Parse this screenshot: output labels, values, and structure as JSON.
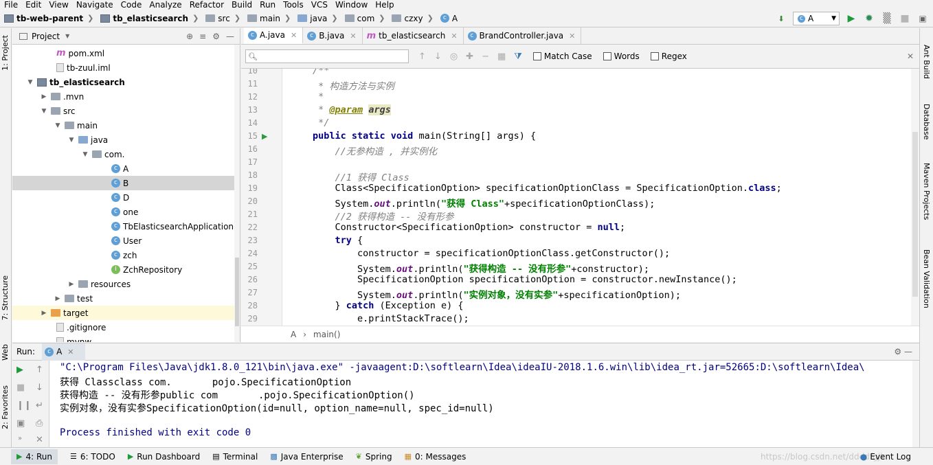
{
  "menu": [
    "File",
    "Edit",
    "View",
    "Navigate",
    "Code",
    "Analyze",
    "Refactor",
    "Build",
    "Run",
    "Tools",
    "VCS",
    "Window",
    "Help"
  ],
  "nav": {
    "crumbs": [
      "tb-web-parent",
      "tb_elasticsearch",
      "src",
      "main",
      "java",
      "com",
      "czxy",
      "A"
    ],
    "run_config": "A"
  },
  "left_strip": {
    "project": "1: Project",
    "structure": "7: Structure",
    "web": "Web",
    "favorites": "2: Favorites"
  },
  "right_strip": [
    "Ant Build",
    "Database",
    "Maven Projects",
    "Bean Validation"
  ],
  "project_panel": {
    "title": "Project",
    "rows": [
      {
        "label": "pom.xml"
      },
      {
        "label": "tb-zuul.iml"
      },
      {
        "label": "tb_elasticsearch"
      },
      {
        "label": ".mvn"
      },
      {
        "label": "src"
      },
      {
        "label": "main"
      },
      {
        "label": "java"
      },
      {
        "label": "com."
      },
      {
        "label": "A"
      },
      {
        "label": "B"
      },
      {
        "label": "D"
      },
      {
        "label": "one"
      },
      {
        "label": "TbElasticsearchApplication"
      },
      {
        "label": "User"
      },
      {
        "label": "zch"
      },
      {
        "label": "ZchRepository"
      },
      {
        "label": "resources"
      },
      {
        "label": "test"
      },
      {
        "label": "target"
      },
      {
        "label": ".gitignore"
      },
      {
        "label": "mvnw"
      }
    ]
  },
  "editor": {
    "tabs": [
      "A.java",
      "B.java",
      "tb_elasticsearch",
      "BrandController.java"
    ],
    "search": {
      "placeholder": "",
      "match_case": "Match Case",
      "words": "Words",
      "regex": "Regex"
    },
    "line_numbers": [
      "10",
      "11",
      "12",
      "13",
      "14",
      "15",
      "16",
      "17",
      "18",
      "19",
      "20",
      "21",
      "22",
      "23",
      "24",
      "25",
      "26",
      "27",
      "28",
      "29"
    ],
    "code": {
      "l10": "/**",
      "l11": " * 构造方法与实例",
      "l12": " *",
      "l13_pre": " * ",
      "l13_tag": "@param",
      "l13_sp": " ",
      "l13_arg": "args",
      "l14": " */",
      "l15_kw": "public static void",
      "l15_rest": " main(String[] args) {",
      "l16": "    //无参构造 , 并实例化",
      "l18": "    //1 获得 Class",
      "l19_pre": "    Class<SpecificationOption> specificationOptionClass = SpecificationOption.",
      "l19_kw": "class",
      "l19_end": ";",
      "l20_pre": "    System.",
      "l20_out": "out",
      "l20_mid": ".println(",
      "l20_str": "\"获得 Class\"",
      "l20_end": "+specificationOptionClass);",
      "l21": "    //2 获得构造 -- 没有形参",
      "l22_pre": "    Constructor<SpecificationOption> constructor = ",
      "l22_kw": "null",
      "l22_end": ";",
      "l23_kw": "    try",
      "l23_end": " {",
      "l24": "        constructor = specificationOptionClass.getConstructor();",
      "l25_pre": "        System.",
      "l25_out": "out",
      "l25_mid": ".println(",
      "l25_str": "\"获得构造 -- 没有形参\"",
      "l25_end": "+constructor);",
      "l26": "        SpecificationOption specificationOption = constructor.newInstance();",
      "l27_pre": "        System.",
      "l27_out": "out",
      "l27_mid": ".println(",
      "l27_str": "\"实例对象，没有实参\"",
      "l27_end": "+specificationOption);",
      "l28_pre": "    } ",
      "l28_kw": "catch",
      "l28_end": " (Exception e) {",
      "l29": "        e.printStackTrace();"
    },
    "breadcrumb": [
      "A",
      "main()"
    ]
  },
  "run": {
    "label": "Run:",
    "tab": "A",
    "console": [
      "\"C:\\Program Files\\Java\\jdk1.8.0_121\\bin\\java.exe\" -javaagent:D:\\softlearn\\Idea\\ideaIU-2018.1.6.win\\lib\\idea_rt.jar=52665:D:\\softlearn\\Idea\\",
      "获得 Classclass com.       pojo.SpecificationOption",
      "获得构造 -- 没有形参public com       .pojo.SpecificationOption()",
      "实例对象，没有实参SpecificationOption(id=null, option_name=null, spec_id=null)",
      "",
      "Process finished with exit code 0"
    ]
  },
  "statusbar": {
    "run": "4: Run",
    "todo": "6: TODO",
    "run_dashboard": "Run Dashboard",
    "terminal": "Terminal",
    "java_enterprise": "Java Enterprise",
    "spring": "Spring",
    "messages": "0: Messages",
    "watermark": "https://blog.csdn.net/ddddfgjk",
    "event_log": "Event Log"
  }
}
